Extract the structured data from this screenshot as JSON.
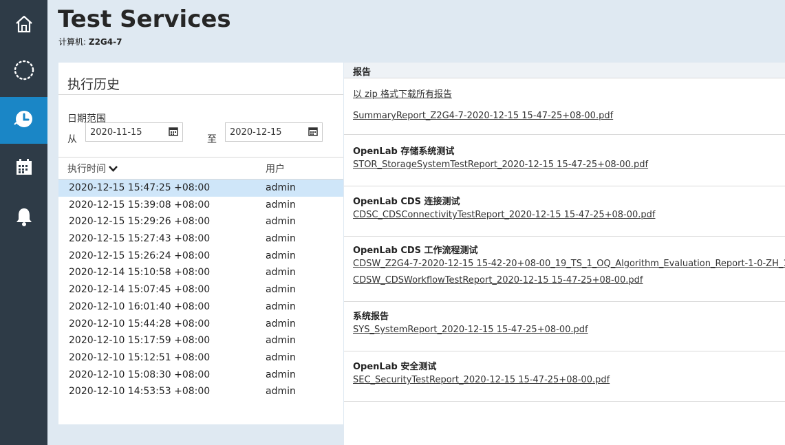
{
  "app": {
    "title": "Test Services",
    "machine_label": "计算机:",
    "machine_name": "Z2G4-7"
  },
  "nav": {
    "items": [
      {
        "icon": "home-icon",
        "active": false
      },
      {
        "icon": "loading-icon",
        "active": false
      },
      {
        "icon": "history-icon",
        "active": true
      },
      {
        "icon": "calendar-icon",
        "active": false
      },
      {
        "icon": "bell-icon",
        "active": false
      }
    ]
  },
  "history": {
    "title": "执行历史",
    "date_range_label": "日期范围",
    "from_label": "从",
    "from_value": "2020-11-15",
    "to_label": "至",
    "to_value": "2020-12-15",
    "col_time": "执行时间",
    "col_user": "用户",
    "rows": [
      {
        "time": "2020-12-15 15:47:25 +08:00",
        "user": "admin"
      },
      {
        "time": "2020-12-15 15:39:08 +08:00",
        "user": "admin"
      },
      {
        "time": "2020-12-15 15:29:26 +08:00",
        "user": "admin"
      },
      {
        "time": "2020-12-15 15:27:43 +08:00",
        "user": "admin"
      },
      {
        "time": "2020-12-15 15:26:24 +08:00",
        "user": "admin"
      },
      {
        "time": "2020-12-14 15:10:58 +08:00",
        "user": "admin"
      },
      {
        "time": "2020-12-14 15:07:45 +08:00",
        "user": "admin"
      },
      {
        "time": "2020-12-10 16:01:40 +08:00",
        "user": "admin"
      },
      {
        "time": "2020-12-10 15:44:28 +08:00",
        "user": "admin"
      },
      {
        "time": "2020-12-10 15:17:59 +08:00",
        "user": "admin"
      },
      {
        "time": "2020-12-10 15:12:51 +08:00",
        "user": "admin"
      },
      {
        "time": "2020-12-10 15:08:30 +08:00",
        "user": "admin"
      },
      {
        "time": "2020-12-10 14:53:53 +08:00",
        "user": "admin"
      }
    ]
  },
  "reports": {
    "header": "报告",
    "download_all": "以 zip 格式下载所有报告",
    "summary": "SummaryReport_Z2G4-7-2020-12-15 15-47-25+08-00.pdf",
    "groups": [
      {
        "title": "OpenLab 存储系统测试",
        "links": [
          "STOR_StorageSystemTestReport_2020-12-15 15-47-25+08-00.pdf"
        ]
      },
      {
        "title": "OpenLab CDS 连接测试",
        "links": [
          "CDSC_CDSConnectivityTestReport_2020-12-15 15-47-25+08-00.pdf"
        ]
      },
      {
        "title": "OpenLab CDS 工作流程测试",
        "links": [
          "CDSW_Z2G4-7-2020-12-15 15-42-20+08-00_19_TS_1_OQ_Algorithm_Evaluation_Report-1-0-ZH_1",
          "CDSW_CDSWorkflowTestReport_2020-12-15 15-47-25+08-00.pdf"
        ]
      },
      {
        "title": "系统报告",
        "links": [
          "SYS_SystemReport_2020-12-15 15-47-25+08-00.pdf"
        ]
      },
      {
        "title": "OpenLab 安全测试",
        "links": [
          "SEC_SecurityTestReport_2020-12-15 15-47-25+08-00.pdf"
        ]
      }
    ]
  }
}
